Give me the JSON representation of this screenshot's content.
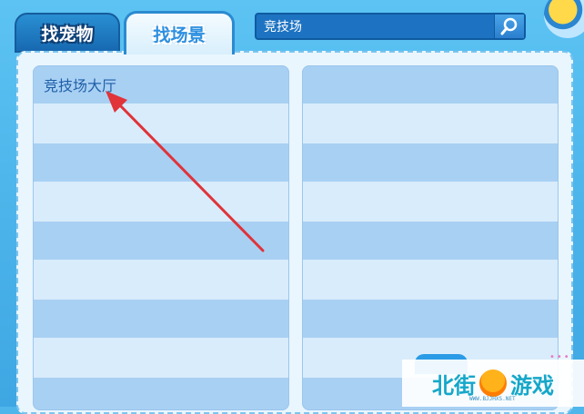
{
  "tabs": [
    {
      "label": "找宠物",
      "selected": false
    },
    {
      "label": "找场景",
      "selected": true
    }
  ],
  "search": {
    "value": "竞技场",
    "icon": "search-icon"
  },
  "scene_list": {
    "items": [
      "竞技场大厅"
    ]
  },
  "watermark": {
    "brand_left": "北街",
    "brand_right": "游戏",
    "url": "WWW.BJJHXS.NET"
  },
  "colors": {
    "frame": "#4fb6ec",
    "selected_tab_text": "#2d8fe0",
    "row_dark": "#a8d0f3",
    "row_light": "#d9ecfb",
    "annotation_arrow": "#e0333a"
  }
}
